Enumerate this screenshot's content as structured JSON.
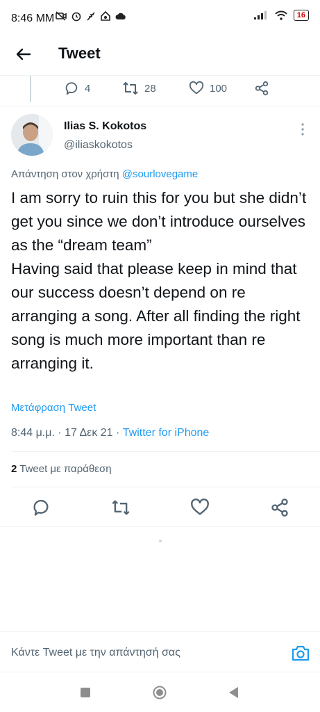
{
  "status_bar": {
    "time": "8:46 MM",
    "battery": "16"
  },
  "header": {
    "title": "Tweet"
  },
  "parent_actions": {
    "replies": "4",
    "retweets": "28",
    "likes": "100"
  },
  "tweet": {
    "author_name": "Ilias S. Kokotos",
    "author_handle": "@iliaskokotos",
    "replying_prefix": "Απάντηση στον χρήστη",
    "replying_to": "@sourlovegame",
    "text": "I am sorry to ruin this for you but she didn’t get you since we don’t introduce ourselves as the “dream team”\nHaving said that please keep in mind that our success doesn’t depend on re arranging a song. After all finding the right song is much more important than re arranging it.",
    "translate_label": "Μετάφραση Tweet",
    "timestamp": "8:44 μ.μ. · 17 Δεκ 21 · ",
    "source": "Twitter for iPhone",
    "quote_count": "2",
    "quote_label": " Tweet με παράθεση"
  },
  "reply_bar": {
    "placeholder": "Κάντε Tweet με την απάντησή σας"
  },
  "colors": {
    "accent": "#1d9bf0",
    "secondary_text": "#536471",
    "primary_text": "#0f1419",
    "divider": "#eff3f4"
  },
  "icons": [
    "back-arrow-icon",
    "reply-icon",
    "retweet-icon",
    "like-icon",
    "share-icon",
    "more-icon",
    "camera-icon"
  ]
}
